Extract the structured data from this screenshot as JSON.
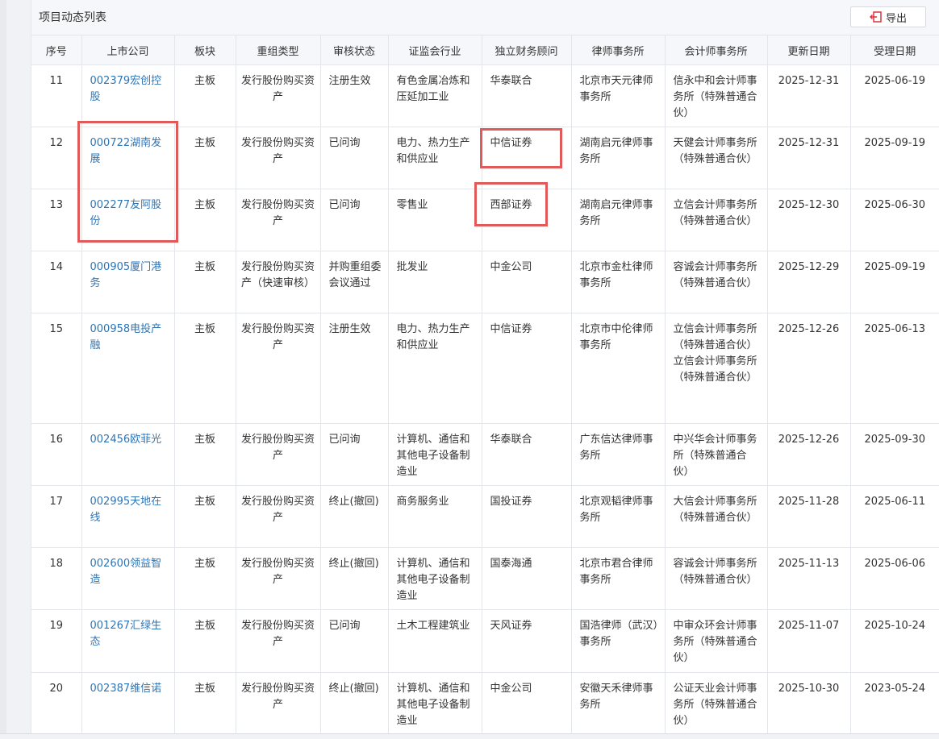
{
  "panel": {
    "title": "项目动态列表",
    "export_label": "导出"
  },
  "table": {
    "headers": [
      "序号",
      "上市公司",
      "板块",
      "重组类型",
      "审核状态",
      "证监会行业",
      "独立财务顾问",
      "律师事务所",
      "会计师事务所",
      "更新日期",
      "受理日期"
    ],
    "rows": [
      {
        "no": "11",
        "company": "002379宏创控股",
        "board": "主板",
        "type": "发行股份购买资产",
        "status": "注册生效",
        "industry": "有色金属冶炼和压延加工业",
        "advisor": "华泰联合",
        "law": "北京市天元律师事务所",
        "accounting": "信永中和会计师事务所（特殊普通合伙）",
        "updated": "2025-12-31",
        "accepted": "2025-06-19"
      },
      {
        "no": "12",
        "company": "000722湖南发展",
        "board": "主板",
        "type": "发行股份购买资产",
        "status": "已问询",
        "industry": "电力、热力生产和供应业",
        "advisor": "中信证券",
        "law": "湖南启元律师事务所",
        "accounting": "天健会计师事务所（特殊普通合伙）",
        "updated": "2025-12-31",
        "accepted": "2025-09-19"
      },
      {
        "no": "13",
        "company": "002277友阿股份",
        "board": "主板",
        "type": "发行股份购买资产",
        "status": "已问询",
        "industry": "零售业",
        "advisor": "西部证券",
        "law": "湖南启元律师事务所",
        "accounting": "立信会计师事务所（特殊普通合伙）",
        "updated": "2025-12-30",
        "accepted": "2025-06-30"
      },
      {
        "no": "14",
        "company": "000905厦门港务",
        "board": "主板",
        "type": "发行股份购买资产（快速审核）",
        "status": "并购重组委会议通过",
        "industry": "批发业",
        "advisor": "中金公司",
        "law": "北京市金杜律师事务所",
        "accounting": "容诚会计师事务所（特殊普通合伙）",
        "updated": "2025-12-29",
        "accepted": "2025-09-19"
      },
      {
        "no": "15",
        "company": "000958电投产融",
        "board": "主板",
        "type": "发行股份购买资产",
        "status": "注册生效",
        "industry": "电力、热力生产和供应业",
        "advisor": "中信证券",
        "law": "北京市中伦律师事务所",
        "accounting": "立信会计师事务所（特殊普通合伙）\n立信会计师事务所（特殊普通合伙）",
        "updated": "2025-12-26",
        "accepted": "2025-06-13"
      },
      {
        "no": "16",
        "company": "002456欧菲光",
        "board": "主板",
        "type": "发行股份购买资产",
        "status": "已问询",
        "industry": "计算机、通信和其他电子设备制造业",
        "advisor": "华泰联合",
        "law": "广东信达律师事务所",
        "accounting": "中兴华会计师事务所（特殊普通合伙）",
        "updated": "2025-12-26",
        "accepted": "2025-09-30"
      },
      {
        "no": "17",
        "company": "002995天地在线",
        "board": "主板",
        "type": "发行股份购买资产",
        "status": "终止(撤回)",
        "industry": "商务服务业",
        "advisor": "国投证券",
        "law": "北京观韬律师事务所",
        "accounting": "大信会计师事务所（特殊普通合伙）",
        "updated": "2025-11-28",
        "accepted": "2025-06-11"
      },
      {
        "no": "18",
        "company": "002600领益智造",
        "board": "主板",
        "type": "发行股份购买资产",
        "status": "终止(撤回)",
        "industry": "计算机、通信和其他电子设备制造业",
        "advisor": "国泰海通",
        "law": "北京市君合律师事务所",
        "accounting": "容诚会计师事务所（特殊普通合伙）",
        "updated": "2025-11-13",
        "accepted": "2025-06-06"
      },
      {
        "no": "19",
        "company": "001267汇绿生态",
        "board": "主板",
        "type": "发行股份购买资产",
        "status": "已问询",
        "industry": "土木工程建筑业",
        "advisor": "天风证券",
        "law": "国浩律师（武汉）事务所",
        "accounting": "中审众环会计师事务所（特殊普通合伙）",
        "updated": "2025-11-07",
        "accepted": "2025-10-24"
      },
      {
        "no": "20",
        "company": "002387维信诺",
        "board": "主板",
        "type": "发行股份购买资产",
        "status": "终止(撤回)",
        "industry": "计算机、通信和其他电子设备制造业",
        "advisor": "中金公司",
        "law": "安徽天禾律师事务所",
        "accounting": "公证天业会计师事务所（特殊普通合伙）",
        "updated": "2025-10-30",
        "accepted": "2023-05-24"
      }
    ]
  },
  "colors": {
    "link": "#2e75b6",
    "highlight": "#e05a5a",
    "header_bg": "#f5f7fa",
    "border": "#e3e6eb"
  }
}
